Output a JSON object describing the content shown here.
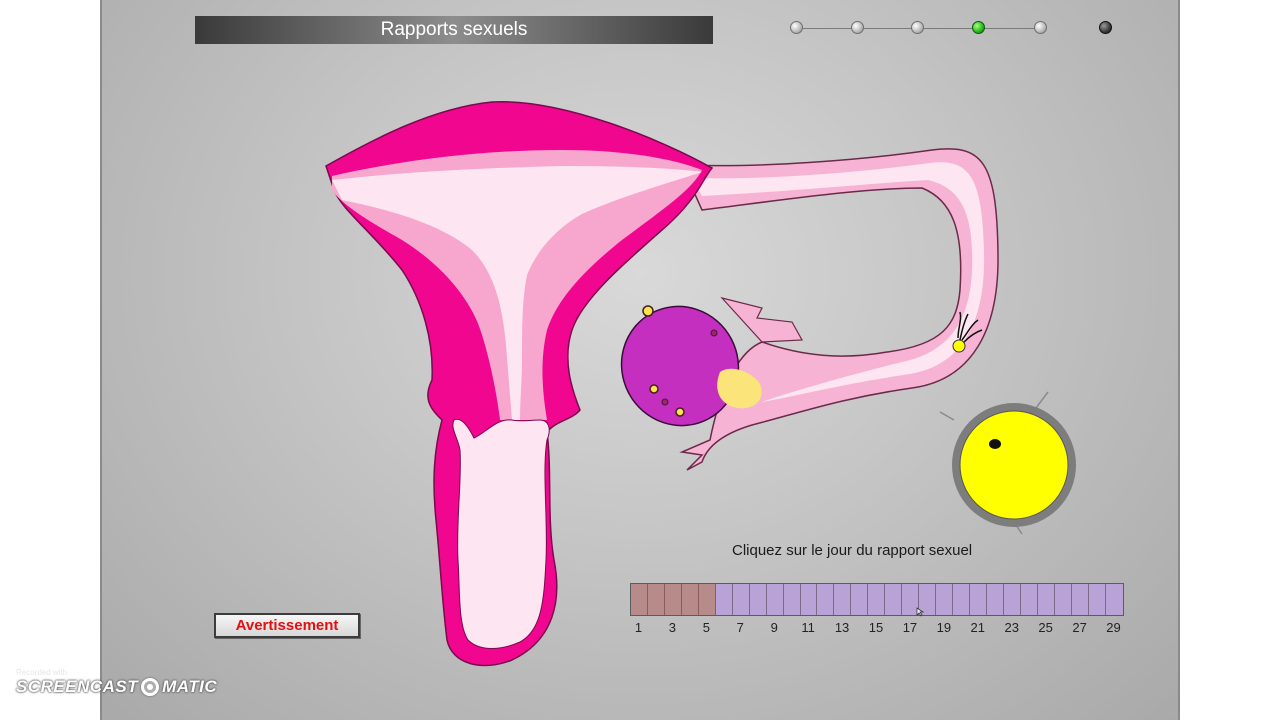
{
  "title": "Rapports sexuels",
  "steps": {
    "count": 6,
    "active_index": 3,
    "last_dark": true
  },
  "instruction": "Cliquez sur le jour du rapport sexuel",
  "calendar": {
    "days": 29,
    "past_days": 5,
    "labels": [
      "1",
      "3",
      "5",
      "7",
      "9",
      "11",
      "13",
      "15",
      "17",
      "19",
      "21",
      "23",
      "25",
      "27",
      "29"
    ]
  },
  "warning_button": "Avertissement",
  "watermark": {
    "recorded": "Recorded with",
    "brand_left": "SCREENCAST",
    "brand_right": "MATIC"
  },
  "colors": {
    "uterus_wall": "#f0068f",
    "endometrium": "#f7a6cd",
    "lumen": "#fbe3f1",
    "ovary": "#c42fbf",
    "ovum": "#ffff00",
    "warning_text": "#e21010",
    "active_step": "#22b61c"
  }
}
